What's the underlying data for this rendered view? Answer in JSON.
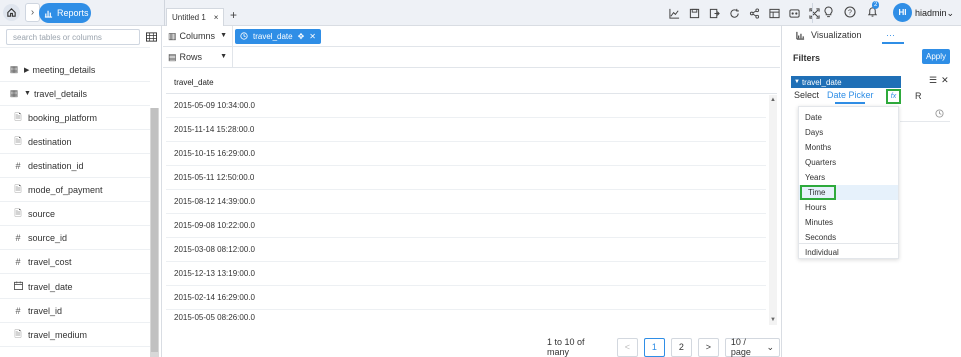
{
  "topbar": {
    "reports_label": "Reports",
    "tab_title": "Untitled 1",
    "tab_close": "×",
    "tab_add": "+",
    "notification_count": "2",
    "avatar_initials": "HI",
    "user_name": "hiadmin"
  },
  "sidebar": {
    "search_placeholder": "search tables or columns",
    "items": [
      {
        "icon": "table-icon",
        "label": "meeting_details"
      },
      {
        "icon": "table-expanded-icon",
        "label": "travel_details"
      },
      {
        "icon": "document-icon",
        "label": "booking_platform"
      },
      {
        "icon": "document-icon",
        "label": "destination"
      },
      {
        "icon": "hash-icon",
        "label": "destination_id"
      },
      {
        "icon": "document-icon",
        "label": "mode_of_payment"
      },
      {
        "icon": "document-icon",
        "label": "source"
      },
      {
        "icon": "hash-icon",
        "label": "source_id"
      },
      {
        "icon": "hash-icon",
        "label": "travel_cost"
      },
      {
        "icon": "calendar-icon",
        "label": "travel_date"
      },
      {
        "icon": "hash-icon",
        "label": "travel_id"
      },
      {
        "icon": "document-icon",
        "label": "travel_medium"
      }
    ]
  },
  "shelves": {
    "columns_label": "Columns",
    "rows_label": "Rows",
    "column_chip": "travel_date"
  },
  "grid": {
    "header": "travel_date",
    "rows": [
      "2015-05-09 10:34:00.0",
      "2015-11-14 15:28:00.0",
      "2015-10-15 16:29:00.0",
      "2015-05-11 12:50:00.0",
      "2015-08-12 14:39:00.0",
      "2015-09-08 10:22:00.0",
      "2015-03-08 08:12:00.0",
      "2015-12-13 13:19:00.0",
      "2015-02-14 16:29:00.0",
      "2015-05-05 08:26:00.0"
    ]
  },
  "pager": {
    "summary": "1 to 10 of many",
    "prev": "<",
    "page1": "1",
    "page2": "2",
    "next": ">",
    "page_size": "10 / page"
  },
  "right": {
    "visualization_label": "Visualization",
    "more_label": "···",
    "filters_title": "Filters",
    "apply_label": "Apply",
    "filter_field": "travel_date",
    "tab_select": "Select",
    "tab_date_picker": "Date Picker",
    "tab_fx": "fx",
    "tab_r": "R",
    "dropdown_items": [
      "Date",
      "Days",
      "Months",
      "Quarters",
      "Years",
      "Time",
      "Hours",
      "Minutes",
      "Seconds",
      "Individual"
    ],
    "selected_item": "Time",
    "accent_color": "#2f8ee6",
    "highlight_color": "#2eaa3c"
  }
}
